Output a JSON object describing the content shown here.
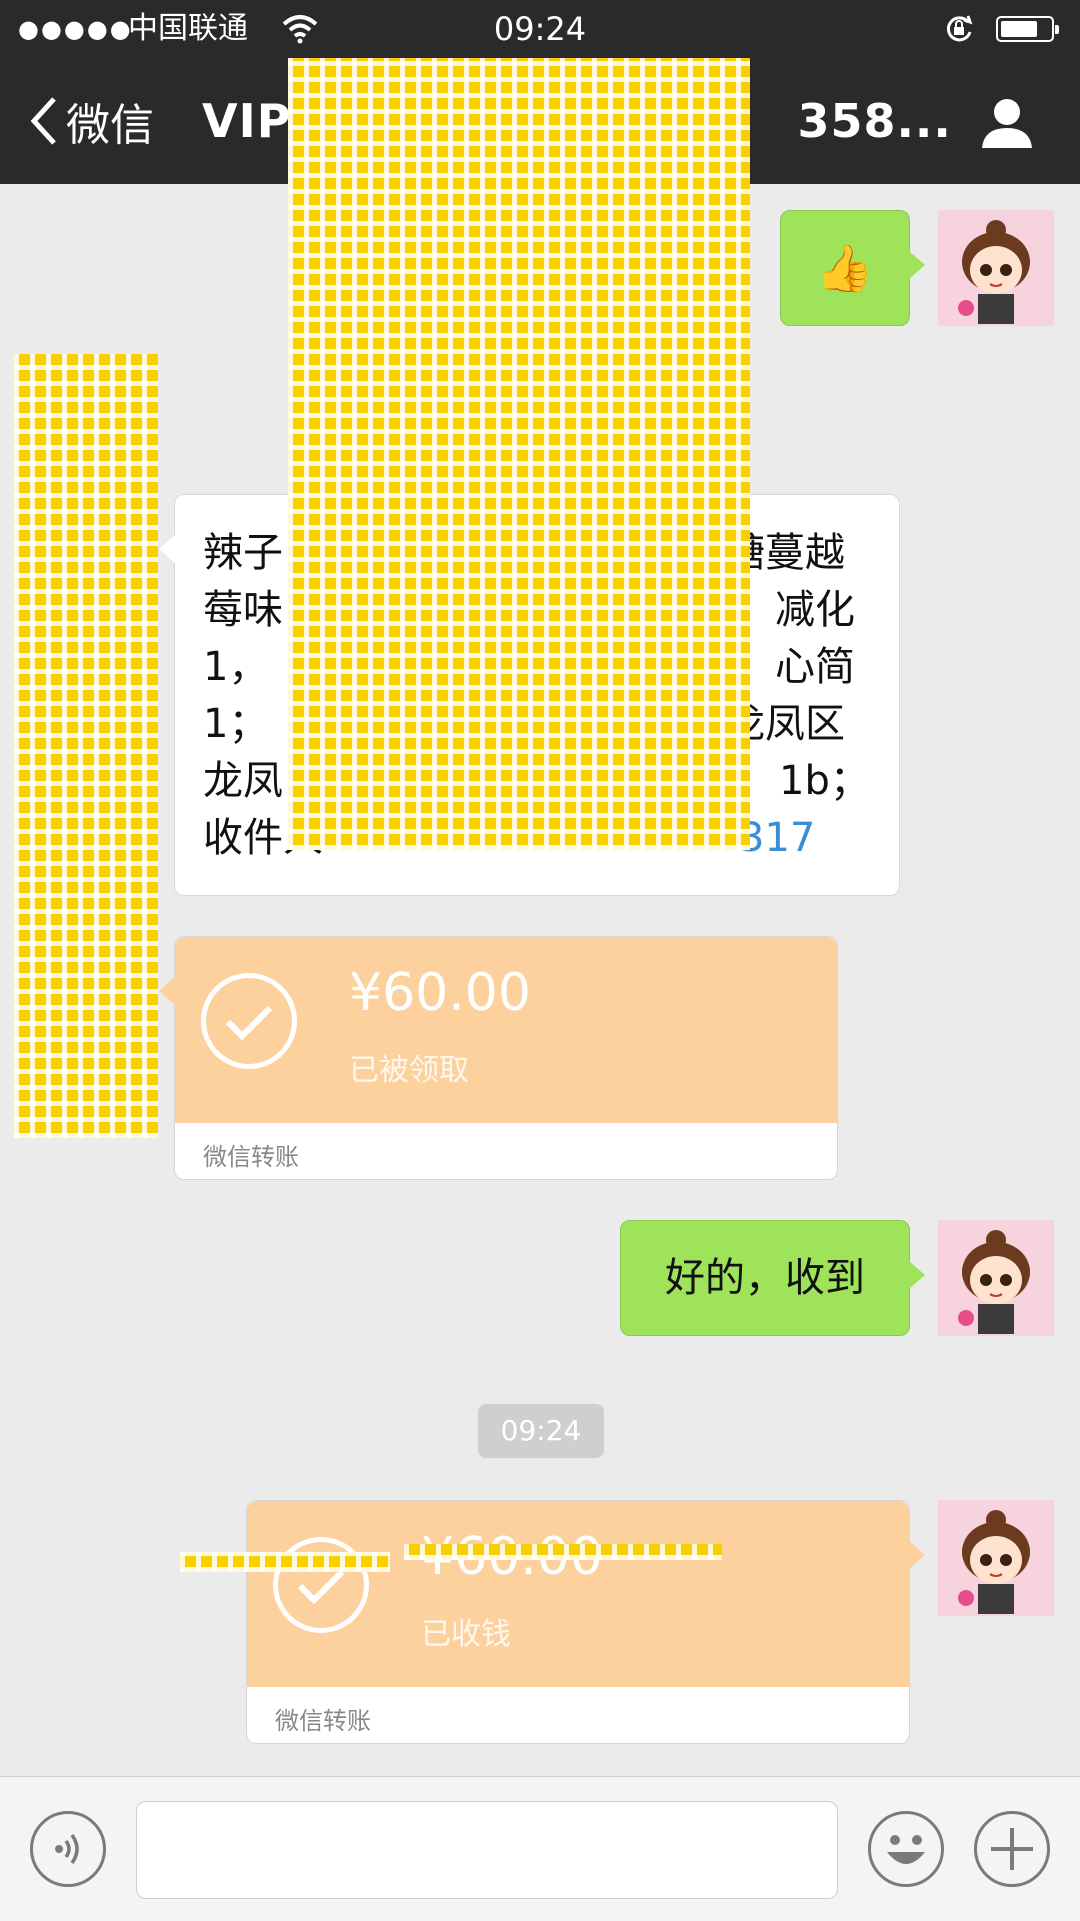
{
  "status_bar": {
    "signal": "●●●●●",
    "carrier": "中国联通",
    "time": "09:24"
  },
  "nav": {
    "back_label": "微信",
    "title_visible_start": "VIP",
    "title_visible_end": "358..."
  },
  "messages": {
    "m1": {
      "sender": "me",
      "emoji": "👍"
    },
    "m2": {
      "sender": "other",
      "lines": [
        "辣子",
        "莓味",
        "1，",
        "1；",
        "龙凤",
        "收件人"
      ],
      "right_fragments": [
        "糖蔓越",
        "减化",
        "心简",
        "龙凤区",
        "1b；"
      ],
      "phone_tail": "317"
    },
    "m3": {
      "sender": "other",
      "type": "transfer",
      "amount": "¥60.00",
      "status": "已被领取",
      "footer": "微信转账"
    },
    "m4": {
      "sender": "me",
      "text": "好的，收到"
    },
    "timestamp": "09:24",
    "m5": {
      "sender": "me",
      "type": "transfer",
      "amount": "¥60.00",
      "status": "已收钱",
      "footer": "微信转账"
    }
  },
  "colors": {
    "nav_bg": "#2a2a2c",
    "bubble_green": "#9fe35a",
    "transfer_orange": "#fdd19e",
    "mosaic_yellow": "#f8d000",
    "link_blue": "#3a8ed6"
  },
  "icons": [
    "wifi-icon",
    "battery-icon",
    "rotation-lock-icon",
    "back-chevron-icon",
    "user-icon",
    "voice-icon",
    "emoji-icon",
    "plus-icon",
    "check-circle-icon"
  ]
}
